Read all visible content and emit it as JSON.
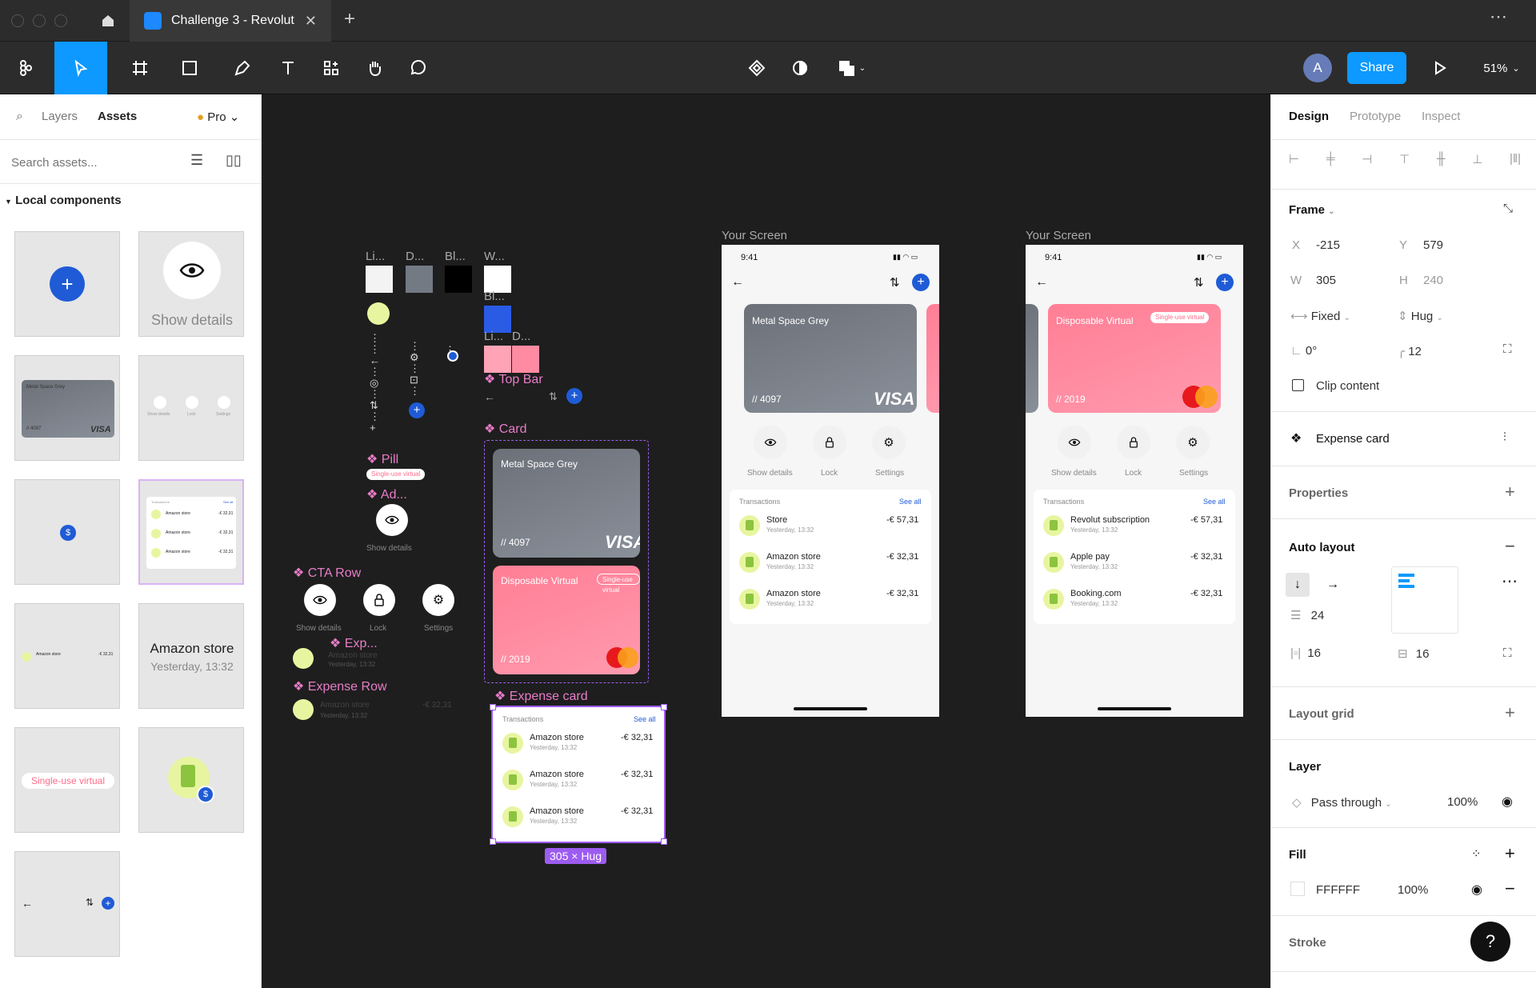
{
  "window": {
    "tab_title": "Challenge 3 - Revolut",
    "new_tab": "+",
    "more": "⋯"
  },
  "toolbar": {
    "share": "Share",
    "avatar": "A",
    "zoom": "51%"
  },
  "left": {
    "tab_layers": "Layers",
    "tab_assets": "Assets",
    "plan": "Pro",
    "search_placeholder": "Search assets...",
    "section": "Local components",
    "tiles": {
      "show_details": "Show details",
      "card_label": "Metal Space Grey",
      "card_num": "// 4097",
      "visa": "VISA",
      "tx_header": "Transactions",
      "see_all": "See all",
      "store": "Amazon store",
      "yesterday": "Yesterday, 13:32",
      "amount": "-€ 32,31",
      "pill": "Single-use virtual",
      "mini_eye": "Show details",
      "mini_lock": "Lock",
      "mini_settings": "Settings"
    }
  },
  "canvas": {
    "swatch_labels": [
      "Li...",
      "D...",
      "Bl...",
      "W...",
      "Bl...",
      "Li...",
      "D..."
    ],
    "comp_top_bar": "Top Bar",
    "comp_card": "Card",
    "comp_pill": "Pill",
    "comp_ad": "Ad...",
    "comp_cta": "CTA Row",
    "comp_exp": "Exp...",
    "comp_expense_row": "Expense Row",
    "comp_expense_card": "Expense card",
    "pill_text": "Single-use virtual",
    "show_details": "Show details",
    "lock": "Lock",
    "settings": "Settings",
    "card1_title": "Metal Space Grey",
    "card1_num": "// 4097",
    "visa": "VISA",
    "card2_title": "Disposable Virtual",
    "card2_pill": "Single-use virtual",
    "card2_num": "// 2019",
    "amazon": "Amazon store",
    "yesterday": "Yesterday, 13:32",
    "amount": "-€ 32,31",
    "tx_header": "Transactions",
    "see_all": "See all",
    "size_badge": "305 × Hug",
    "screen_label": "Your Screen",
    "phone1": {
      "time": "9:41",
      "card_title": "Metal Space Grey",
      "card_num": "// 4097",
      "visa": "VISA",
      "rows": [
        {
          "name": "Store",
          "time": "Yesterday, 13:32",
          "amount": "-€ 57,31"
        },
        {
          "name": "Amazon store",
          "time": "Yesterday, 13:32",
          "amount": "-€ 32,31"
        },
        {
          "name": "Amazon store",
          "time": "Yesterday, 13:32",
          "amount": "-€ 32,31"
        }
      ]
    },
    "phone2": {
      "time": "9:41",
      "card_title": "Disposable Virtual",
      "card_pill": "Single-use virtual",
      "card_num": "// 2019",
      "rows": [
        {
          "name": "Revolut subscription",
          "time": "Yesterday, 13:32",
          "amount": "-€ 57,31"
        },
        {
          "name": "Apple pay",
          "time": "Yesterday, 13:32",
          "amount": "-€ 32,31"
        },
        {
          "name": "Booking.com",
          "time": "Yesterday, 13:32",
          "amount": "-€ 32,31"
        }
      ]
    }
  },
  "right": {
    "tab_design": "Design",
    "tab_prototype": "Prototype",
    "tab_inspect": "Inspect",
    "frame": "Frame",
    "x_label": "X",
    "x": "-215",
    "y_label": "Y",
    "y": "579",
    "w_label": "W",
    "w": "305",
    "h_label": "H",
    "h": "240",
    "fixed": "Fixed",
    "hug": "Hug",
    "rotation": "0°",
    "radius": "12",
    "clip": "Clip content",
    "component": "Expense card",
    "properties": "Properties",
    "auto_layout": "Auto layout",
    "gap": "24",
    "pad_h": "16",
    "pad_v": "16",
    "layout_grid": "Layout grid",
    "layer": "Layer",
    "blend": "Pass through",
    "opacity": "100%",
    "fill": "Fill",
    "fill_hex": "FFFFFF",
    "fill_opacity": "100%",
    "stroke": "Stroke",
    "help": "?"
  }
}
